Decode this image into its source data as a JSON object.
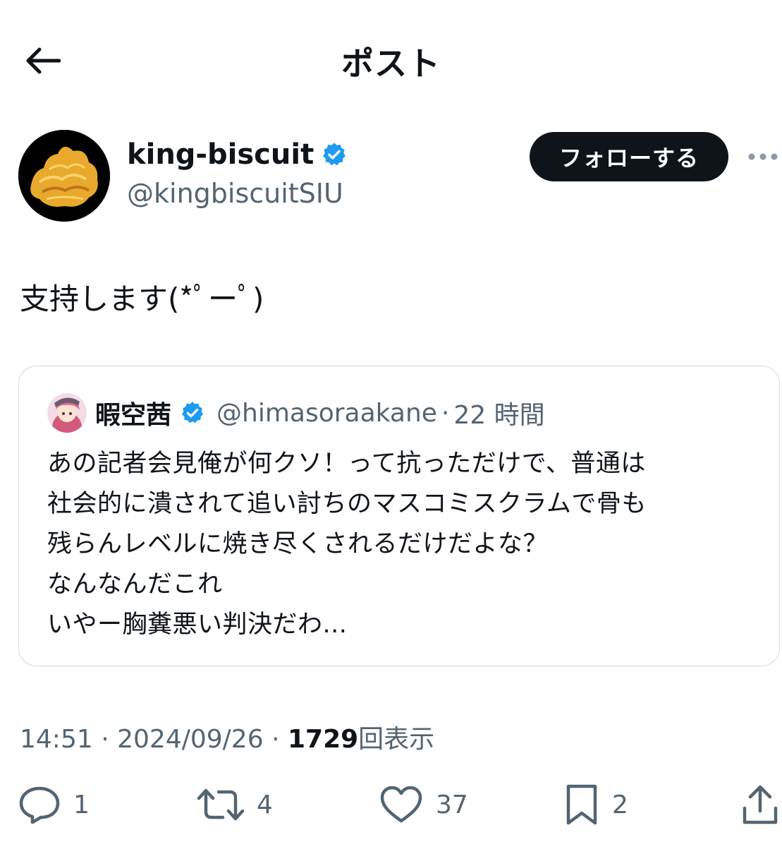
{
  "header": {
    "title": "ポスト"
  },
  "author": {
    "display_name": "king-biscuit",
    "handle": "@kingbiscuitSIU",
    "follow_label": "フォローする"
  },
  "tweet": {
    "text": "支持します(*ﾟーﾟ)"
  },
  "quote": {
    "display_name": "暇空茜",
    "handle": "@himasoraakane",
    "separator": "·",
    "time": "22 時間",
    "lines": [
      "あの記者会見俺が何クソ！って抗っただけで、普通は",
      "社会的に潰されて追い討ちのマスコミスクラムで骨も",
      "残らんレベルに焼き尽くされるだけだよな？",
      "なんなんだこれ",
      "いやー胸糞悪い判決だわ..."
    ]
  },
  "meta": {
    "time": "14:51",
    "date": "2024/09/26",
    "separator": "·",
    "views": "1729",
    "views_label": "回表示"
  },
  "actions": {
    "replies": "1",
    "reposts": "4",
    "likes": "37",
    "bookmarks": "2"
  },
  "colors": {
    "text": "#0f1419",
    "secondary": "#536471",
    "verified": "#1d9bf0",
    "border": "#cfd9de"
  }
}
